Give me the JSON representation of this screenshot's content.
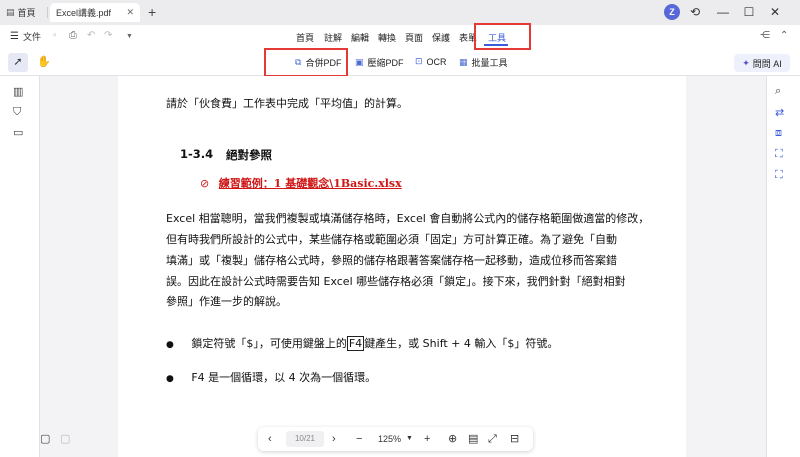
{
  "titlebar": {
    "home_tab": "首頁",
    "file_tab": "Excel講義.pdf",
    "close": "✕",
    "new_tab": "+",
    "avatar": "Z"
  },
  "toolbar": {
    "file_menu": "文件",
    "tabs": [
      "首頁",
      "註解",
      "編輯",
      "轉換",
      "頁面",
      "保護",
      "表單",
      "工具"
    ],
    "active_tab": "工具"
  },
  "tools": {
    "merge": "合併PDF",
    "compress": "壓縮PDF",
    "ocr": "OCR",
    "batch": "批量工具",
    "ai": "問問 AI"
  },
  "document": {
    "line1": "請於「伙食費」工作表中完成「平均值」的計算。",
    "section_number": "1-3.4",
    "section_title": "絕對參照",
    "example": "練習範例：1 基礎觀念\\1Basic.xlsx",
    "para": [
      "Excel 相當聰明，當我們複製或填滿儲存格時，Excel 會自動將公式內的儲存格範圍做適當的修改，",
      "但有時我們所設計的公式中，某些儲存格或範圍必須「固定」方可計算正確。為了避免「自動",
      "填滿」或「複製」儲存格公式時，參照的儲存格跟著答案儲存格一起移動，造成位移而答案錯",
      "誤。因此在設計公式時需要告知 Excel 哪些儲存格必須「鎖定」。接下來，我們針對「絕對相對",
      "參照」作進一步的解說。"
    ],
    "bullet1_before": "鎖定符號「$」，可使用鍵盤上的",
    "bullet1_key": "F4",
    "bullet1_after": "鍵產生，或 Shift + 4 輸入「$」符號。",
    "bullet2": "F4 是一個循環，以 4 次為一個循環。"
  },
  "nav": {
    "page": "10/21",
    "zoom": "125%"
  },
  "colors": {
    "accent": "#3b5bdb",
    "highlight": "#e53935",
    "example_red": "#d01515"
  }
}
